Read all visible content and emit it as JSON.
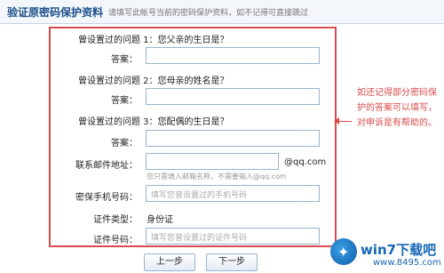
{
  "header": {
    "title": "验证原密码保护资料",
    "subtitle": "请填写此帐号当前的密码保护资料，如不记得可直接跳过"
  },
  "form": {
    "q1_label": "曾设置过的问题 1：您父亲的生日是？",
    "q2_label": "曾设置过的问题 2：您母亲的姓名是？",
    "q3_label": "曾设置过的问题 3：您配偶的生日是？",
    "answer_label": "答案：",
    "email_label": "联系邮件地址：",
    "email_hint": "您只需填入邮箱名称，不需要输入@qq.com",
    "email_suffix": "@qq.com",
    "phone_label": "密保手机号码：",
    "phone_placeholder": "填写您曾设置过的手机号码",
    "id_type_label": "证件类型：",
    "id_type_value": "身份证",
    "id_number_label": "证件号码：",
    "id_number_placeholder": "填写您曾设置过的证件号码"
  },
  "note": {
    "text": "如还记得部分密码保护的答案可以填写，对申诉是有帮助的。",
    "color": "#d94b4b"
  },
  "buttons": {
    "prev_label": "上一步",
    "next_label": "下一步"
  },
  "watermark": {
    "brand": "win7下载吧",
    "url": "www.8495.com"
  }
}
